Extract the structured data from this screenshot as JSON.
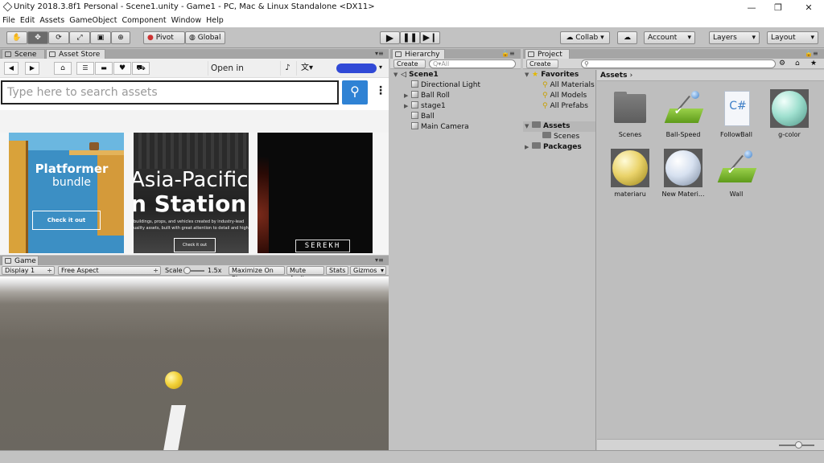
{
  "window": {
    "title": "Unity 2018.3.8f1 Personal - Scene1.unity - Game1 - PC, Mac & Linux Standalone <DX11>",
    "minimize": "—",
    "maximize": "❐",
    "close": "✕"
  },
  "menu": [
    "File",
    "Edit",
    "Assets",
    "GameObject",
    "Component",
    "Window",
    "Help"
  ],
  "toolbar": {
    "tools": [
      "hand-icon",
      "move-icon",
      "rotate-icon",
      "scale-icon",
      "rect-icon",
      "transform-icon"
    ],
    "pivot": "Pivot",
    "global": "Global",
    "collab": "Collab ▾",
    "account": "Account",
    "layers": "Layers",
    "layout": "Layout"
  },
  "scene_tabs": {
    "scene": "Scene",
    "asset_store": "Asset Store"
  },
  "store": {
    "open_in_browser": "Open in Browser",
    "search_placeholder": "Type here to search assets",
    "cards": [
      {
        "title": "Platformer",
        "subtitle": "bundle",
        "cta": "Check it out"
      },
      {
        "title": "Asia-Pacific",
        "subtitle": "n Station P",
        "body": "buildings, props, and vehicles created by industry-lead\nuality assets, built with great attention to detail and high",
        "cta": "Check it out"
      },
      {
        "title": "SEREKH"
      }
    ]
  },
  "game": {
    "tab": "Game",
    "display": "Display 1",
    "aspect": "Free Aspect",
    "scale_label": "Scale",
    "scale_value": "1.5x",
    "maximize": "Maximize On Play",
    "mute": "Mute Audio",
    "stats": "Stats",
    "gizmos": "Gizmos"
  },
  "hierarchy": {
    "tab": "Hierarchy",
    "create": "Create",
    "search_placeholder": "Q▾All",
    "scene": "Scene1",
    "items": [
      "Directional Light",
      "Ball Roll",
      "stage1",
      "Ball",
      "Main Camera"
    ]
  },
  "project": {
    "tab": "Project",
    "create": "Create",
    "favorites": "Favorites",
    "favorite_items": [
      "All Materials",
      "All Models",
      "All Prefabs"
    ],
    "assets_folder": "Assets",
    "assets_children": [
      "Scenes"
    ],
    "packages": "Packages",
    "breadcrumb": "Assets",
    "assets": [
      {
        "name": "Scenes",
        "type": "folder"
      },
      {
        "name": "Ball-Speed",
        "type": "physic"
      },
      {
        "name": "FollowBall",
        "type": "script"
      },
      {
        "name": "g-color",
        "type": "material-teal"
      },
      {
        "name": "materiaru",
        "type": "material-yellow"
      },
      {
        "name": "New Materi...",
        "type": "material-white"
      },
      {
        "name": "Wall",
        "type": "physic"
      }
    ]
  },
  "colors": {
    "unity_bg": "#c2c2c2",
    "store_search_button": "#2f82d4",
    "platformer_card": "#3c8fc4",
    "ball": "#f3d23a",
    "selected_folder": "#b7b7b7"
  }
}
